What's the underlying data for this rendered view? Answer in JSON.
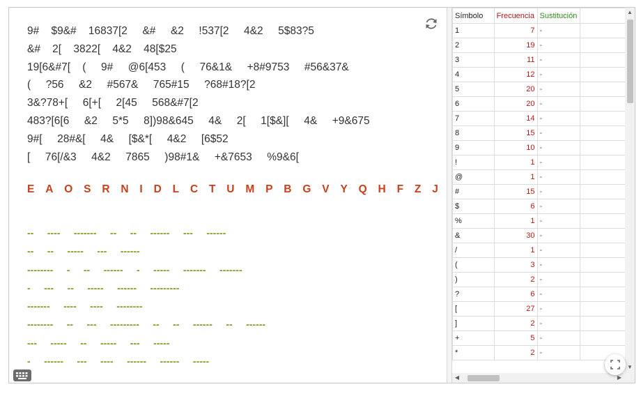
{
  "cipher_lines": [
    "9#    $9&#    16837[2     &#     &2     !537[2     4&2     5$83?5",
    "&#    2[    3822[    4&2    48[$25",
    "19[6&#7[    (     9#     @6[453     (     76&1&     +8#9753     #56&37&",
    "(     ?56     &2     #567&     765#15     ?68#18?[2",
    "3&?78+[     6[+[     2[45     568&#7[2",
    "483?[6[6     &2     5*5     8])98&645     4&     2[     1[$&][     4&     +9&675",
    "9#[     28#&[     4&     [$&*[     4&2     [6$52",
    "[     76[/&3     4&2     7865     )98#1&     +&7653     %9&6["
  ],
  "frequency_letters": [
    "E",
    "A",
    "O",
    "S",
    "R",
    "N",
    "I",
    "D",
    "L",
    "C",
    "T",
    "U",
    "M",
    "P",
    "B",
    "G",
    "V",
    "Y",
    "Q",
    "H",
    "F",
    "Z",
    "J"
  ],
  "substitution_lines": [
    "--     ----     -------     --     --     ------     ---     ------",
    "--     --     -----     ---     ------",
    "--------     -     --     ------     -     -----     -------     -------",
    "-     ---     --     -----     ------     ---------",
    "-------     ----     ----     --------",
    "--------     --     ---     ---------     --     --     ------     --     ------",
    "---     -----     --     -----     ---     -----",
    "-     ------     ---     ----     ------     ------     -----"
  ],
  "sheet": {
    "headers": {
      "symbol": "Símbolo",
      "frequency": "Frecuencia",
      "substitution": "Sustitución"
    },
    "rows": [
      {
        "symbol": "1",
        "frequency": "7",
        "substitution": "-"
      },
      {
        "symbol": "2",
        "frequency": "19",
        "substitution": "-"
      },
      {
        "symbol": "3",
        "frequency": "11",
        "substitution": "-"
      },
      {
        "symbol": "4",
        "frequency": "12",
        "substitution": "-"
      },
      {
        "symbol": "5",
        "frequency": "20",
        "substitution": "-"
      },
      {
        "symbol": "6",
        "frequency": "20",
        "substitution": "-"
      },
      {
        "symbol": "7",
        "frequency": "14",
        "substitution": "-"
      },
      {
        "symbol": "8",
        "frequency": "15",
        "substitution": "-"
      },
      {
        "symbol": "9",
        "frequency": "10",
        "substitution": "-"
      },
      {
        "symbol": "!",
        "frequency": "1",
        "substitution": "-"
      },
      {
        "symbol": "@",
        "frequency": "1",
        "substitution": "-"
      },
      {
        "symbol": "#",
        "frequency": "15",
        "substitution": "-"
      },
      {
        "symbol": "$",
        "frequency": "6",
        "substitution": "-"
      },
      {
        "symbol": "%",
        "frequency": "1",
        "substitution": "-"
      },
      {
        "symbol": "&",
        "frequency": "30",
        "substitution": "-"
      },
      {
        "symbol": "/",
        "frequency": "1",
        "substitution": "-"
      },
      {
        "symbol": "(",
        "frequency": "3",
        "substitution": "-"
      },
      {
        "symbol": ")",
        "frequency": "2",
        "substitution": "-"
      },
      {
        "symbol": "?",
        "frequency": "6",
        "substitution": "-"
      },
      {
        "symbol": "[",
        "frequency": "27",
        "substitution": "-"
      },
      {
        "symbol": "]",
        "frequency": "2",
        "substitution": "-"
      },
      {
        "symbol": "+",
        "frequency": "5",
        "substitution": "-"
      },
      {
        "symbol": "*",
        "frequency": "2",
        "substitution": "-"
      }
    ]
  },
  "icons": {
    "refresh": "refresh-icon",
    "keyboard": "keyboard-icon",
    "fullscreen": "fullscreen-icon"
  },
  "colors": {
    "cipher_text": "#333333",
    "frequency_letters": "#c8401c",
    "substitution_dashes": "#7a9a1a",
    "frequency_column": "#b11a1a",
    "substitution_column": "#2c8a1c"
  }
}
